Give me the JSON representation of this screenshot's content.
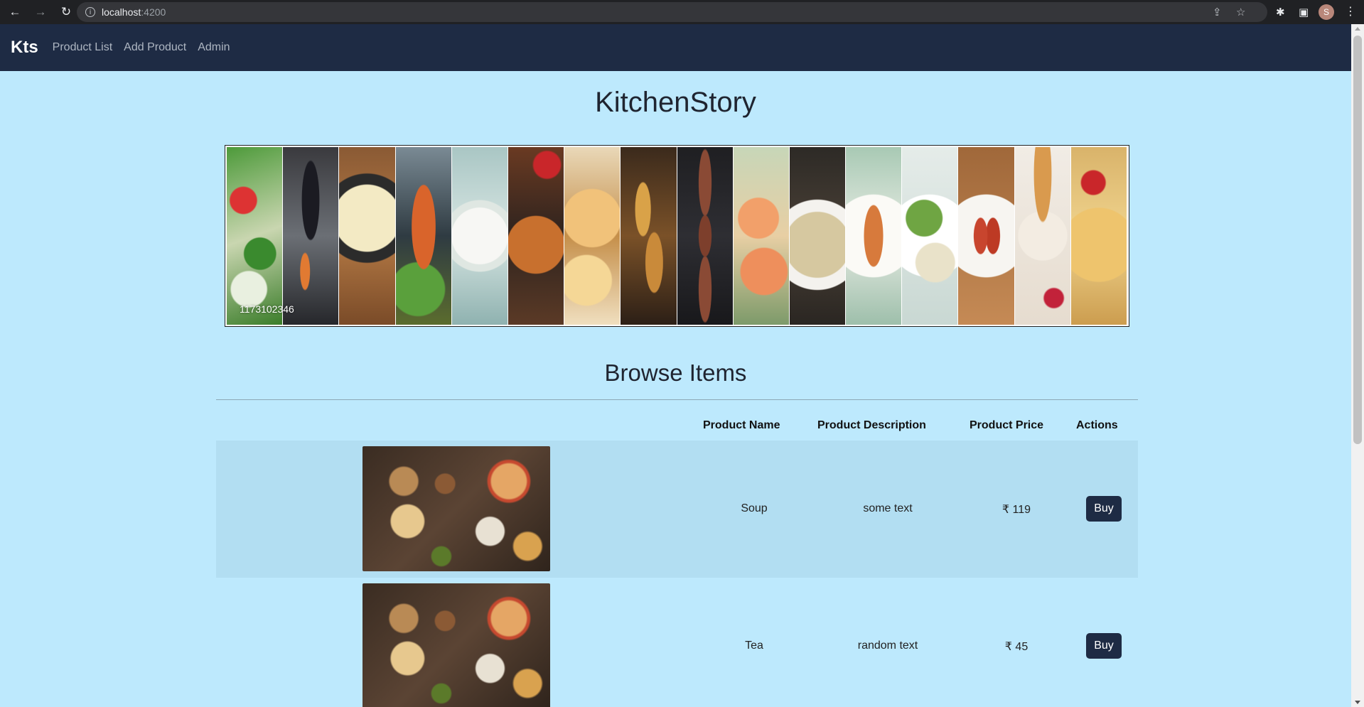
{
  "browser": {
    "url_host": "localhost",
    "url_port": ":4200",
    "profile_initial": "S"
  },
  "navbar": {
    "brand": "Kts",
    "links": [
      "Product List",
      "Add Product",
      "Admin"
    ]
  },
  "main": {
    "title": "KitchenStory",
    "banner_caption": "1173102346",
    "section_title": "Browse Items"
  },
  "table": {
    "headers": [
      "Product Name",
      "Product Description",
      "Product Price",
      "Actions"
    ],
    "rows": [
      {
        "name": "Soup",
        "description": "some text",
        "price": "₹ 119",
        "action": "Buy"
      },
      {
        "name": "Tea",
        "description": "random text",
        "price": "₹ 45",
        "action": "Buy"
      }
    ]
  },
  "colors": {
    "page_bg": "#bde9fd",
    "navbar_bg": "#1e2b44",
    "row_stripe": "#b2def2"
  }
}
